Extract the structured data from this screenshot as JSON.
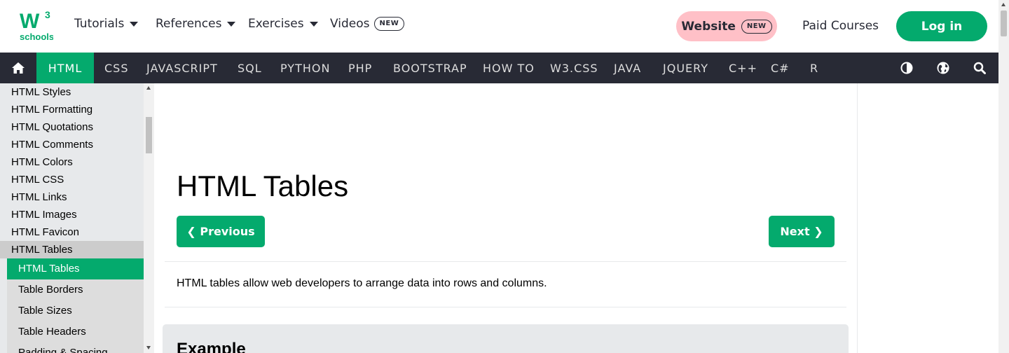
{
  "topbar": {
    "logo_text": "schools",
    "logo_w": "W",
    "logo_sup": "3",
    "nav": [
      {
        "label": "Tutorials"
      },
      {
        "label": "References"
      },
      {
        "label": "Exercises"
      }
    ],
    "videos_label": "Videos",
    "videos_badge": "NEW",
    "website_label": "Website",
    "website_badge": "NEW",
    "paid_courses_label": "Paid Courses",
    "login_label": "Log in"
  },
  "darknav": {
    "items": [
      "HTML",
      "CSS",
      "JAVASCRIPT",
      "SQL",
      "PYTHON",
      "PHP",
      "BOOTSTRAP",
      "HOW TO",
      "W3.CSS",
      "JAVA",
      "JQUERY",
      "C++",
      "C#",
      "R"
    ],
    "active": "HTML"
  },
  "sidebar": {
    "items": [
      "HTML Styles",
      "HTML Formatting",
      "HTML Quotations",
      "HTML Comments",
      "HTML Colors",
      "HTML CSS",
      "HTML Links",
      "HTML Images",
      "HTML Favicon",
      "HTML Tables"
    ],
    "open_item": "HTML Tables",
    "sub_items": [
      "HTML Tables",
      "Table Borders",
      "Table Sizes",
      "Table Headers",
      "Padding & Spacing"
    ],
    "active_sub": "HTML Tables"
  },
  "main": {
    "title": "HTML Tables",
    "prev_label": "❮ Previous",
    "next_label": "Next ❯",
    "intro": "HTML tables allow web developers to arrange data into rows and columns.",
    "example_title": "Example"
  },
  "colors": {
    "accent": "#04aa6d",
    "dark_nav": "#282a35",
    "website_pink": "#ffc0c7",
    "sidebar_bg": "#e7e9eb"
  },
  "icons": [
    "home-icon",
    "contrast-icon",
    "globe-icon",
    "search-icon",
    "caret-down-icon"
  ]
}
